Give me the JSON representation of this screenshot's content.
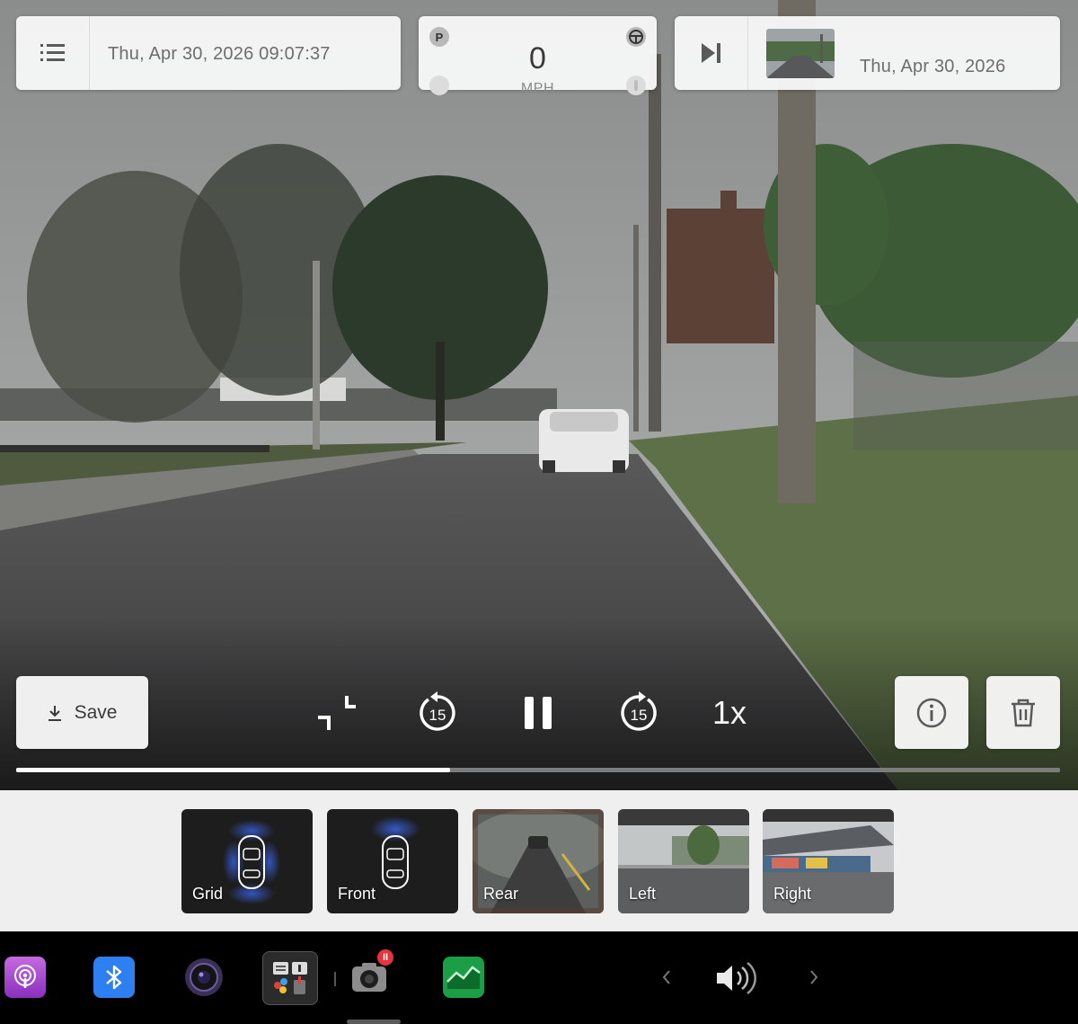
{
  "top_left": {
    "menu_icon": "list-icon",
    "timestamp": "Thu, Apr 30, 2026 09:07:37"
  },
  "telemetry": {
    "gear": "P",
    "speed": "0",
    "unit": "MPH",
    "steering_icon": "steering-wheel-icon",
    "brake_icon": "brake-pedal-icon",
    "accel_icon": "accelerator-pedal-icon"
  },
  "top_right": {
    "next_icon": "skip-next-icon",
    "clip_date": "Thu, Apr 30, 2026"
  },
  "controls": {
    "save_label": "Save",
    "save_icon": "download-icon",
    "fit_icon": "fit-screen-icon",
    "back_icon": "rewind-15-icon",
    "back_seconds": "15",
    "pause_icon": "pause-icon",
    "forward_icon": "forward-15-icon",
    "forward_seconds": "15",
    "playback_speed": "1x",
    "info_icon": "info-icon",
    "trash_icon": "trash-icon",
    "progress_fraction": 0.416
  },
  "cameras": [
    {
      "label": "Grid"
    },
    {
      "label": "Front"
    },
    {
      "label": "Rear"
    },
    {
      "label": "Left"
    },
    {
      "label": "Right"
    }
  ],
  "taskbar": {
    "apps": [
      "podcasts-icon",
      "bluetooth-icon",
      "camera-icon",
      "toybox-icon",
      "dashcam-icon",
      "energy-icon"
    ],
    "dashcam_badge": "II",
    "volume_icon": "volume-icon"
  },
  "colors": {
    "card_bg": "#f6f6f6",
    "progress": "#ffffff",
    "podcasts": "#a646d6",
    "bluetooth": "#2e7ff2",
    "energy": "#1c9e46",
    "badge": "#e5343c"
  }
}
